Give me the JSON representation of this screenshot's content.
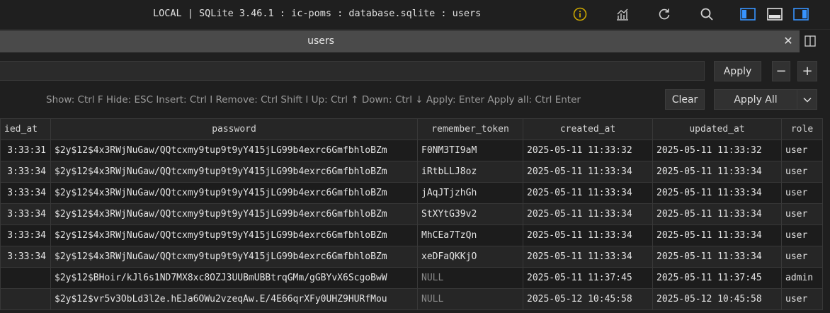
{
  "window": {
    "title": "LOCAL | SQLite 3.46.1 : ic-poms : database.sqlite : users",
    "toolbar_icons": [
      "info-icon",
      "chart-icon",
      "refresh-icon",
      "search-icon",
      "panel-left-icon",
      "panel-bottom-icon",
      "panel-right-icon"
    ],
    "accent_color": "#3794ff",
    "warning_color": "#cca700"
  },
  "tab": {
    "label": "users",
    "close_glyph": "✕"
  },
  "filter": {
    "value": "",
    "apply_label": "Apply",
    "minus_label": "−",
    "plus_label": "+"
  },
  "help": {
    "text": "Show: Ctrl F Hide: ESC Insert: Ctrl I Remove: Ctrl Shift I Up: Ctrl ↑ Down: Ctrl ↓ Apply: Enter Apply all: Ctrl Enter",
    "clear_label": "Clear",
    "apply_all_label": "Apply All",
    "dropdown_glyph": "⌄"
  },
  "table": {
    "columns": [
      "ied_at",
      "password",
      "remember_token",
      "created_at",
      "updated_at",
      "role"
    ],
    "rows": [
      [
        "3:33:31",
        "$2y$12$4x3RWjNuGaw/QQtcxmy9tup9t9yY415jLG99b4exrc6GmfbhloBZm",
        "F0NM3TI9aM",
        "2025-05-11 11:33:32",
        "2025-05-11 11:33:32",
        "user"
      ],
      [
        "3:33:34",
        "$2y$12$4x3RWjNuGaw/QQtcxmy9tup9t9yY415jLG99b4exrc6GmfbhloBZm",
        "iRtbLLJ8oz",
        "2025-05-11 11:33:34",
        "2025-05-11 11:33:34",
        "user"
      ],
      [
        "3:33:34",
        "$2y$12$4x3RWjNuGaw/QQtcxmy9tup9t9yY415jLG99b4exrc6GmfbhloBZm",
        "jAqJTjzhGh",
        "2025-05-11 11:33:34",
        "2025-05-11 11:33:34",
        "user"
      ],
      [
        "3:33:34",
        "$2y$12$4x3RWjNuGaw/QQtcxmy9tup9t9yY415jLG99b4exrc6GmfbhloBZm",
        "StXYtG39v2",
        "2025-05-11 11:33:34",
        "2025-05-11 11:33:34",
        "user"
      ],
      [
        "3:33:34",
        "$2y$12$4x3RWjNuGaw/QQtcxmy9tup9t9yY415jLG99b4exrc6GmfbhloBZm",
        "MhCEa7TzQn",
        "2025-05-11 11:33:34",
        "2025-05-11 11:33:34",
        "user"
      ],
      [
        "3:33:34",
        "$2y$12$4x3RWjNuGaw/QQtcxmy9tup9t9yY415jLG99b4exrc6GmfbhloBZm",
        "xeDFaQKKjO",
        "2025-05-11 11:33:34",
        "2025-05-11 11:33:34",
        "user"
      ],
      [
        "",
        "$2y$12$BHoir/kJl6s1ND7MX8xc8OZJ3UUBmUBBtrqGMm/gGBYvX6ScgoBwW",
        "NULL",
        "2025-05-11 11:37:45",
        "2025-05-11 11:37:45",
        "admin"
      ],
      [
        "",
        "$2y$12$vr5v3ObLd3l2e.hEJa6OWu2vzeqAw.E/4E66qrXFy0UHZ9HURfMou",
        "NULL",
        "2025-05-12 10:45:58",
        "2025-05-12 10:45:58",
        "user"
      ]
    ]
  }
}
